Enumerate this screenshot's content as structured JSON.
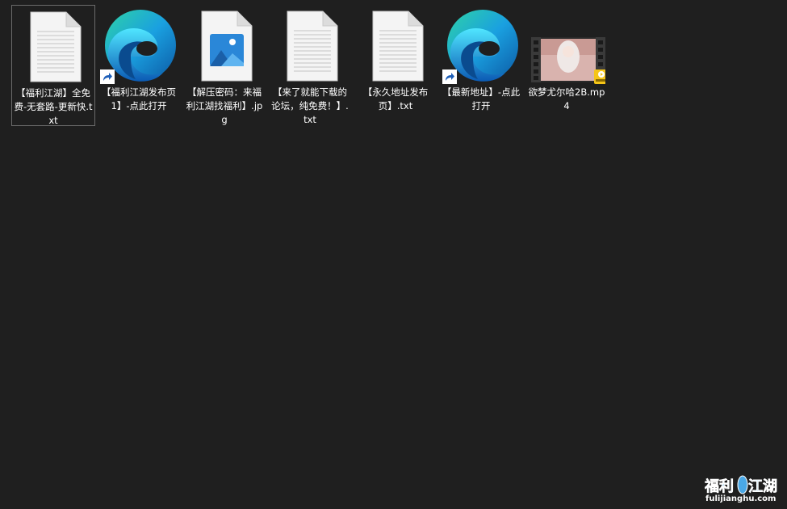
{
  "files": [
    {
      "label": "【福利江湖】全免费-无套路-更新快.txt",
      "icon": "text-document-icon"
    },
    {
      "label": "【福利江湖发布页1】-点此打开",
      "icon": "edge-shortcut-icon"
    },
    {
      "label": "【解压密码：来福利江湖找福利】.jpg",
      "icon": "image-file-icon"
    },
    {
      "label": "【来了就能下载的论坛，纯免费！】.txt",
      "icon": "text-document-icon"
    },
    {
      "label": "【永久地址发布页】.txt",
      "icon": "text-document-icon"
    },
    {
      "label": "【最新地址】-点此打开",
      "icon": "edge-shortcut-icon"
    },
    {
      "label": "欲梦尤尔哈2B.mp4",
      "icon": "video-file-icon"
    }
  ],
  "watermark": {
    "title": "福利江湖",
    "url": "fulijianghu.com"
  },
  "colors": {
    "background": "#1f1f1f",
    "label_text": "#ffffff",
    "selection_border": "#6b6b6b"
  }
}
